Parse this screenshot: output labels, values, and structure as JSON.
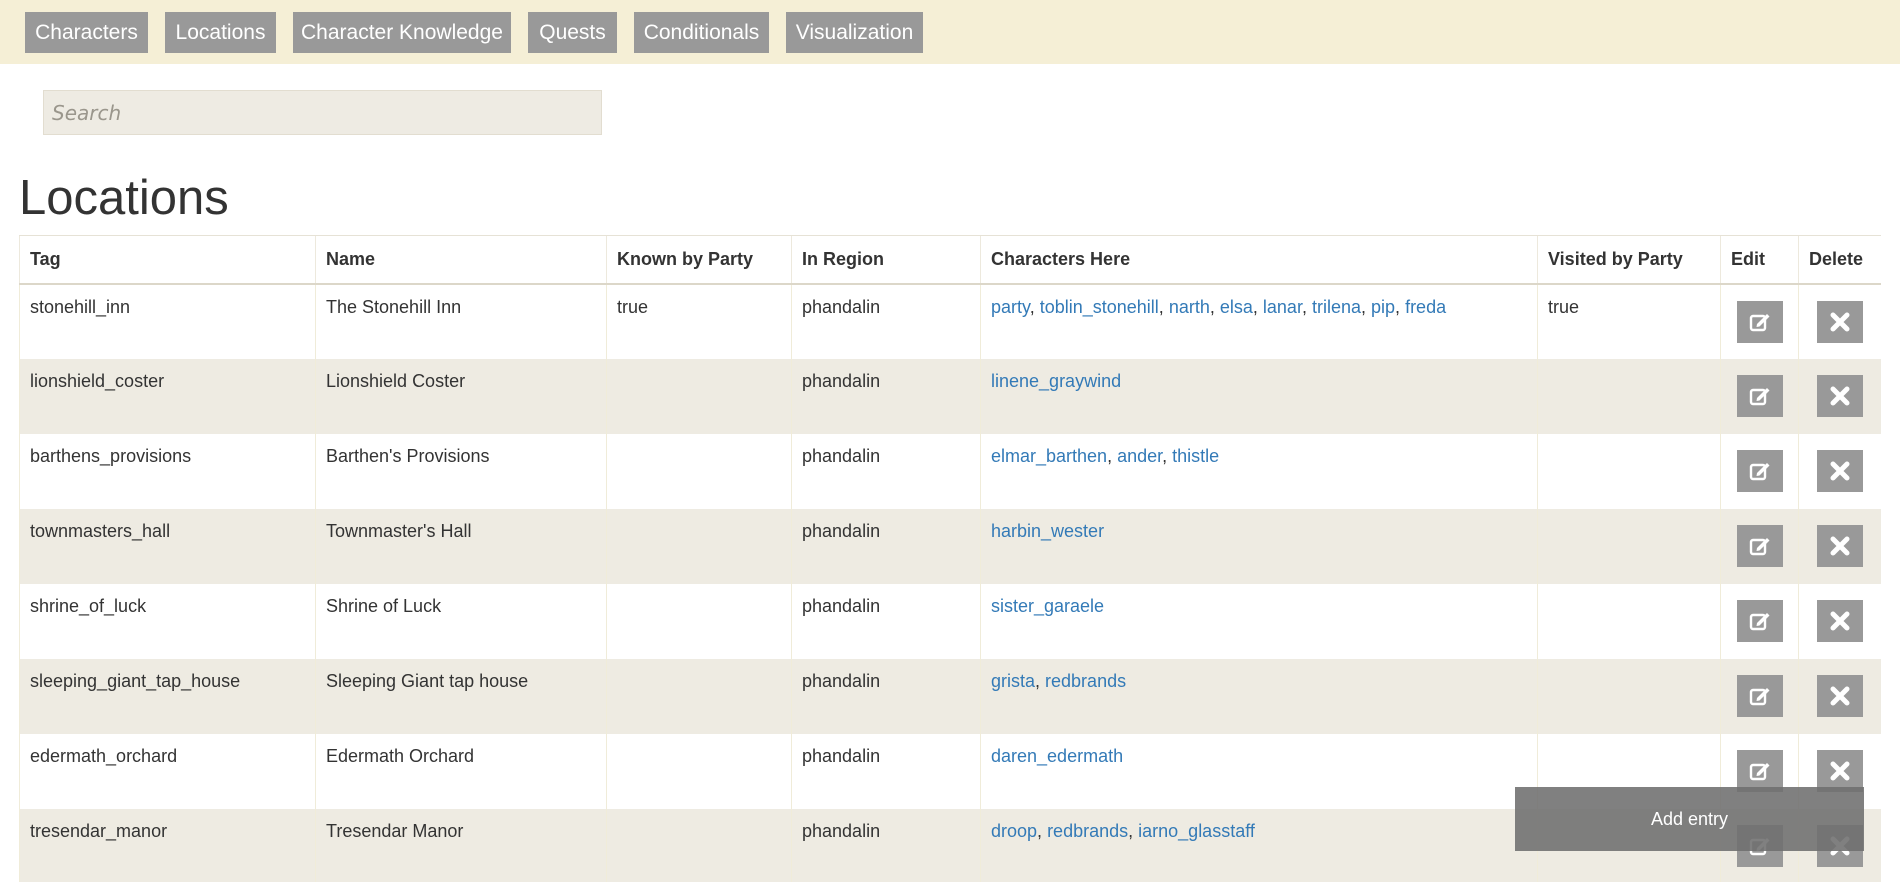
{
  "nav": {
    "items": [
      {
        "label": "Characters"
      },
      {
        "label": "Locations"
      },
      {
        "label": "Character Knowledge"
      },
      {
        "label": "Quests"
      },
      {
        "label": "Conditionals"
      },
      {
        "label": "Visualization"
      }
    ]
  },
  "search": {
    "placeholder": "Search",
    "value": ""
  },
  "page": {
    "title": "Locations"
  },
  "table": {
    "columns": [
      "Tag",
      "Name",
      "Known by Party",
      "In Region",
      "Characters Here",
      "Visited by Party",
      "Edit",
      "Delete"
    ],
    "rows": [
      {
        "tag": "stonehill_inn",
        "name": "The Stonehill Inn",
        "known": "true",
        "region": "phandalin",
        "characters": [
          "party",
          "toblin_stonehill",
          "narth",
          "elsa",
          "lanar",
          "trilena",
          "pip",
          "freda"
        ],
        "visited": "true"
      },
      {
        "tag": "lionshield_coster",
        "name": "Lionshield Coster",
        "known": "",
        "region": "phandalin",
        "characters": [
          "linene_graywind"
        ],
        "visited": ""
      },
      {
        "tag": "barthens_provisions",
        "name": "Barthen's Provisions",
        "known": "",
        "region": "phandalin",
        "characters": [
          "elmar_barthen",
          "ander",
          "thistle"
        ],
        "visited": ""
      },
      {
        "tag": "townmasters_hall",
        "name": "Townmaster's Hall",
        "known": "",
        "region": "phandalin",
        "characters": [
          "harbin_wester"
        ],
        "visited": ""
      },
      {
        "tag": "shrine_of_luck",
        "name": "Shrine of Luck",
        "known": "",
        "region": "phandalin",
        "characters": [
          "sister_garaele"
        ],
        "visited": ""
      },
      {
        "tag": "sleeping_giant_tap_house",
        "name": "Sleeping Giant tap house",
        "known": "",
        "region": "phandalin",
        "characters": [
          "grista",
          "redbrands"
        ],
        "visited": ""
      },
      {
        "tag": "edermath_orchard",
        "name": "Edermath Orchard",
        "known": "",
        "region": "phandalin",
        "characters": [
          "daren_edermath"
        ],
        "visited": ""
      },
      {
        "tag": "tresendar_manor",
        "name": "Tresendar Manor",
        "known": "",
        "region": "phandalin",
        "characters": [
          "droop",
          "redbrands",
          "iarno_glasstaff"
        ],
        "visited": ""
      }
    ],
    "edit_icon": "edit-icon",
    "delete_icon": "close-icon"
  },
  "add_entry": {
    "label": "Add entry"
  },
  "colors": {
    "nav_bg": "#f5efd6",
    "button_gray": "#999999",
    "link": "#337ab7",
    "stripe": "#eeebe2"
  }
}
